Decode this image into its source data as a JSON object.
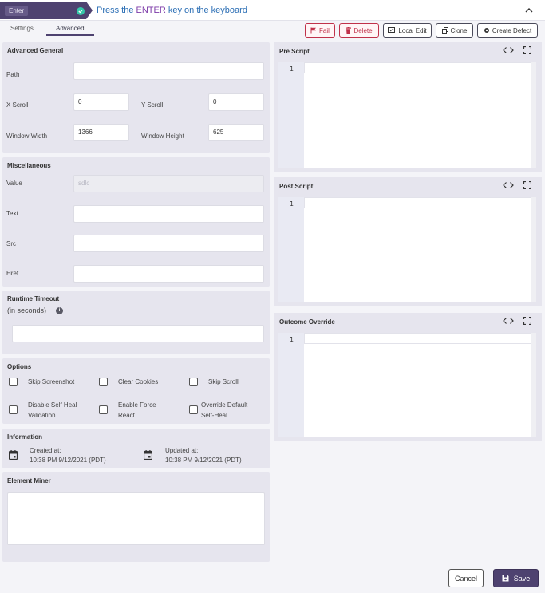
{
  "header": {
    "step_label": "Enter",
    "title_prefix": "Press the ",
    "title_keyword": "ENTER",
    "title_suffix": " key on the keyboard"
  },
  "tabs": [
    {
      "label": "Settings",
      "active": false
    },
    {
      "label": "Advanced",
      "active": true
    }
  ],
  "actions": {
    "fail": "Fail",
    "delete": "Delete",
    "local_edit": "Local Edit",
    "clone": "Clone",
    "create_defect": "Create Defect"
  },
  "advanced_general": {
    "title": "Advanced General",
    "path_label": "Path",
    "path_value": "",
    "x_scroll_label": "X Scroll",
    "x_scroll_value": "0",
    "y_scroll_label": "Y Scroll",
    "y_scroll_value": "0",
    "window_width_label": "Window Width",
    "window_width_value": "1366",
    "window_height_label": "Window Height",
    "window_height_value": "625"
  },
  "miscellaneous": {
    "title": "Miscellaneous",
    "value_label": "Value",
    "value_value": "sdlc",
    "text_label": "Text",
    "text_value": "",
    "src_label": "Src",
    "src_value": "",
    "href_label": "Href",
    "href_value": ""
  },
  "runtime": {
    "title": "Runtime Timeout",
    "subtitle": "(in seconds)",
    "value": ""
  },
  "options": {
    "title": "Options",
    "skip_screenshot": "Skip Screenshot",
    "clear_cookies": "Clear Cookies",
    "skip_scroll": "Skip Scroll",
    "disable_self_heal_1": "Disable Self Heal",
    "disable_self_heal_2": "Validation",
    "enable_force_1": "Enable Force",
    "enable_force_2": "React",
    "override_1": "Override Default",
    "override_2": "Self-Heal"
  },
  "information": {
    "title": "Information",
    "created_label": "Created at:",
    "created_value": "10:38 PM 9/12/2021 (PDT)",
    "updated_label": "Updated at:",
    "updated_value": "10:38 PM 9/12/2021 (PDT)"
  },
  "element_miner": {
    "title": "Element Miner",
    "value": ""
  },
  "editors": {
    "pre_script": "Pre Script",
    "post_script": "Post Script",
    "outcome_override": "Outcome Override",
    "line_number": "1"
  },
  "footer": {
    "cancel": "Cancel",
    "save": "Save"
  },
  "colors": {
    "brand": "#4e4270",
    "accent_blue": "#2c6fb5",
    "danger": "#c0314a",
    "success": "#35c7a9"
  },
  "icons": [
    "check-circle-icon",
    "chevron-up-icon",
    "flag-icon",
    "trash-icon",
    "local-edit-icon",
    "clone-icon",
    "gear-icon",
    "info-icon",
    "calendar-icon",
    "code-icon",
    "fullscreen-icon",
    "save-icon"
  ]
}
